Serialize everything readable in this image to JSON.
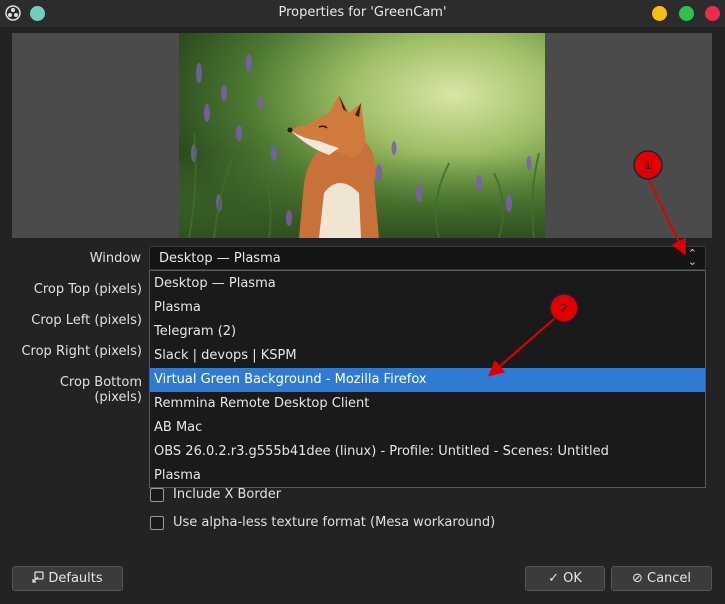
{
  "window": {
    "title": "Properties for 'GreenCam'",
    "colors": {
      "minimize": "#f6bd16",
      "maximize": "#2ec24d",
      "close": "#f2294b",
      "sticky": "#6fd0c0",
      "selection": "#2f7bd3"
    }
  },
  "preview": {
    "image": "fox-in-meadow-photo"
  },
  "form": {
    "window_label": "Window",
    "window_value": "Desktop — Plasma",
    "crop_top_label": "Crop Top (pixels)",
    "crop_left_label": "Crop Left (pixels)",
    "crop_right_label": "Crop Right (pixels)",
    "crop_bottom_label": "Crop Bottom (pixels)"
  },
  "dropdown": {
    "items": [
      "Desktop — Plasma",
      "Plasma",
      "Telegram (2)",
      "Slack | devops | KSPM",
      "Virtual Green Background - Mozilla Firefox",
      "Remmina Remote Desktop Client",
      "AB Mac",
      "OBS 26.0.2.r3.g555b41dee (linux) - Profile: Untitled - Scenes: Untitled",
      "Plasma"
    ],
    "selected_index": 4
  },
  "checkboxes": {
    "include_border": "Include X Border",
    "alpha_less": "Use alpha-less texture format (Mesa workaround)"
  },
  "buttons": {
    "defaults": "Defaults",
    "ok": "OK",
    "cancel": "Cancel"
  },
  "annotations": {
    "marker1": "1",
    "marker2": "2",
    "color": "#e00000"
  }
}
